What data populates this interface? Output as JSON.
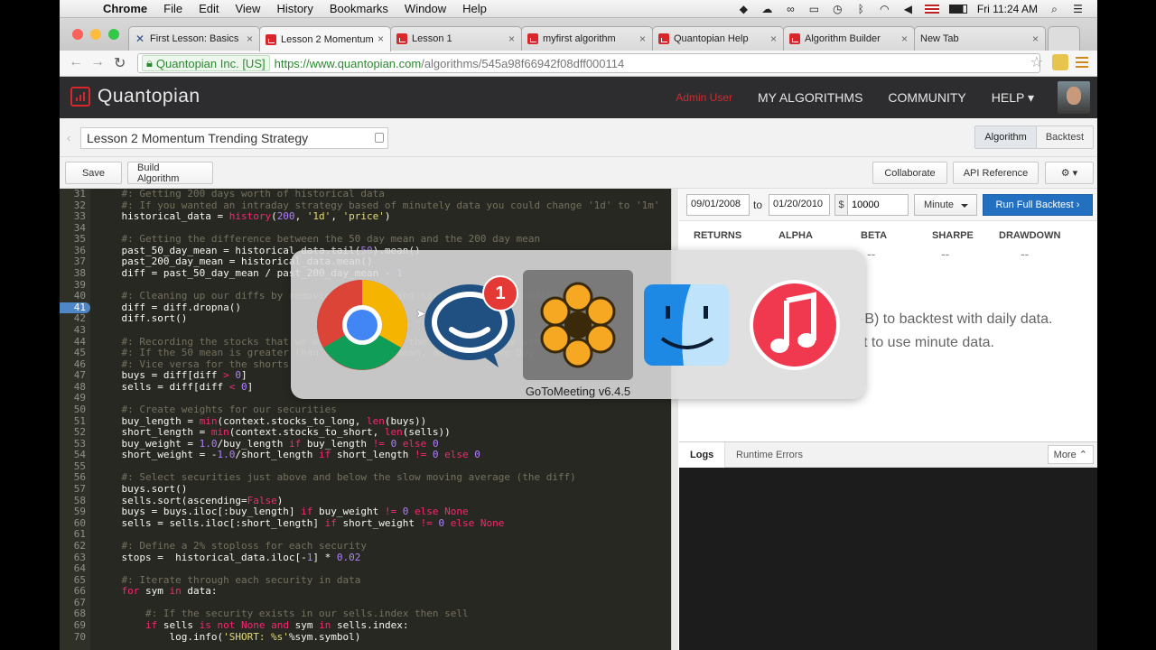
{
  "menubar": {
    "app": "Chrome",
    "items": [
      "File",
      "Edit",
      "View",
      "History",
      "Bookmarks",
      "Window",
      "Help"
    ],
    "clock": "Fri 11:24 AM"
  },
  "tabs": [
    {
      "title": "First Lesson: Basics",
      "favicon": "x-icon",
      "active": false
    },
    {
      "title": "Lesson 2 Momentum",
      "favicon": "quantopian-icon",
      "active": true
    },
    {
      "title": "Lesson 1",
      "favicon": "quantopian-icon",
      "active": false
    },
    {
      "title": "myfirst algorithm",
      "favicon": "quantopian-icon",
      "active": false
    },
    {
      "title": "Quantopian Help",
      "favicon": "quantopian-icon",
      "active": false
    },
    {
      "title": "Algorithm Builder",
      "favicon": "quantopian-icon",
      "active": false
    },
    {
      "title": "New Tab",
      "favicon": "none",
      "active": false
    }
  ],
  "address": {
    "ev_label": "Quantopian Inc. [US]",
    "url_scheme_host": "https://www.quantopian.com",
    "url_path": "/algorithms/545a98f66942f08dff000114"
  },
  "site": {
    "brand": "Quantopian",
    "admin": "Admin User",
    "nav": [
      "MY ALGORITHMS",
      "COMMUNITY",
      "HELP ▾"
    ]
  },
  "algorithm": {
    "name": "Lesson 2 Momentum Trending Strategy",
    "view_tabs": [
      "Algorithm",
      "Backtest"
    ]
  },
  "toolbar": {
    "save": "Save",
    "build": "Build Algorithm",
    "collaborate": "Collaborate",
    "api": "API Reference"
  },
  "editor": {
    "current_line": 41,
    "lines": [
      {
        "n": 31,
        "t": "    #: Getting 200 days worth of historical data"
      },
      {
        "n": 32,
        "t": "    #: If you wanted an intraday strategy based of minutely data you could change '1d' to '1m'"
      },
      {
        "n": 33,
        "t": "    historical_data = history(200, '1d', 'price')"
      },
      {
        "n": 34,
        "t": ""
      },
      {
        "n": 35,
        "t": "    #: Getting the difference between the 50 day mean and the 200 day mean"
      },
      {
        "n": 36,
        "t": "    past_50_day_mean = historical_data.tail(50).mean()"
      },
      {
        "n": 37,
        "t": "    past_200_day_mean = historical_data.mean()"
      },
      {
        "n": 38,
        "t": "    diff = past_50_day_mean / past_200_day_mean - 1"
      },
      {
        "n": 39,
        "t": ""
      },
      {
        "n": 40,
        "t": "    #: Cleaning up our diffs by removing any NaNs and sorting it in ascending order"
      },
      {
        "n": 41,
        "t": "    diff = diff.dropna()"
      },
      {
        "n": 42,
        "t": "    diff.sort()"
      },
      {
        "n": 43,
        "t": ""
      },
      {
        "n": 44,
        "t": "    #: Recording the stocks that we want to buy and the stocks that we want to sell"
      },
      {
        "n": 45,
        "t": "    #: If the 50 mean is greater than the 200 day mean, add it to the buy"
      },
      {
        "n": 46,
        "t": "    #: Vice versa for the shorts"
      },
      {
        "n": 47,
        "t": "    buys = diff[diff > 0]"
      },
      {
        "n": 48,
        "t": "    sells = diff[diff < 0]"
      },
      {
        "n": 49,
        "t": ""
      },
      {
        "n": 50,
        "t": "    #: Create weights for our securities"
      },
      {
        "n": 51,
        "t": "    buy_length = min(context.stocks_to_long, len(buys))"
      },
      {
        "n": 52,
        "t": "    short_length = min(context.stocks_to_short, len(sells))"
      },
      {
        "n": 53,
        "t": "    buy_weight = 1.0/buy_length if buy_length != 0 else 0"
      },
      {
        "n": 54,
        "t": "    short_weight = -1.0/short_length if short_length != 0 else 0"
      },
      {
        "n": 55,
        "t": ""
      },
      {
        "n": 56,
        "t": "    #: Select securities just above and below the slow moving average (the diff)"
      },
      {
        "n": 57,
        "t": "    buys.sort()"
      },
      {
        "n": 58,
        "t": "    sells.sort(ascending=False)"
      },
      {
        "n": 59,
        "t": "    buys = buys.iloc[:buy_length] if buy_weight != 0 else None"
      },
      {
        "n": 60,
        "t": "    sells = sells.iloc[:short_length] if short_weight != 0 else None"
      },
      {
        "n": 61,
        "t": ""
      },
      {
        "n": 62,
        "t": "    #: Define a 2% stoploss for each security"
      },
      {
        "n": 63,
        "t": "    stops =  historical_data.iloc[-1] * 0.02"
      },
      {
        "n": 64,
        "t": ""
      },
      {
        "n": 65,
        "t": "    #: Iterate through each security in data"
      },
      {
        "n": 66,
        "t": "    for sym in data:"
      },
      {
        "n": 67,
        "t": ""
      },
      {
        "n": 68,
        "t": "        #: If the security exists in our sells.index then sell"
      },
      {
        "n": 69,
        "t": "        if sells is not None and sym in sells.index:"
      },
      {
        "n": 70,
        "t": "            log.info('SHORT: %s'%sym.symbol)"
      }
    ]
  },
  "backtest": {
    "start_date": "09/01/2008",
    "to": "to",
    "end_date": "01/20/2010",
    "currency": "$",
    "capital": "10000",
    "frequency": "Minute",
    "run": "Run Full Backtest",
    "metrics": [
      {
        "label": "RETURNS",
        "value": ""
      },
      {
        "label": "ALPHA",
        "value": ""
      },
      {
        "label": "BETA",
        "value": "--"
      },
      {
        "label": "SHARPE",
        "value": "--"
      },
      {
        "label": "DRAWDOWN",
        "value": "--"
      }
    ],
    "hint_line1": "-B) to backtest with daily data.",
    "hint_line2": "t to use minute data."
  },
  "logs": {
    "tab_logs": "Logs",
    "tab_errors": "Runtime Errors",
    "more": "More ⌃"
  },
  "switcher": {
    "apps": [
      "chrome-icon",
      "hipchat-icon",
      "gotomeeting-icon",
      "finder-icon",
      "itunes-icon"
    ],
    "selected_label": "GoToMeeting v6.4.5",
    "badge": "1"
  }
}
